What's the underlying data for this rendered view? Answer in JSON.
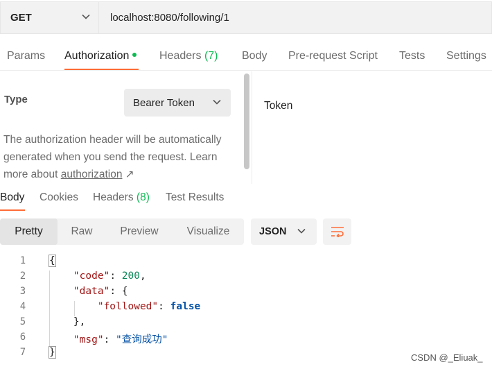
{
  "request": {
    "method": "GET",
    "url": "localhost:8080/following/1"
  },
  "request_tabs": {
    "params": "Params",
    "authorization": "Authorization",
    "headers_label": "Headers",
    "headers_count": "(7)",
    "body": "Body",
    "prerequest": "Pre-request Script",
    "tests": "Tests",
    "settings": "Settings"
  },
  "auth": {
    "type_label": "Type",
    "type_value": "Bearer Token",
    "description": "The authorization header will be automatically generated when you send the request. Learn more about ",
    "link_text": "authorization",
    "link_arrow": "↗",
    "token_label": "Token"
  },
  "response_tabs": {
    "body": "Body",
    "cookies": "Cookies",
    "headers_label": "Headers",
    "headers_count": "(8)",
    "test_results": "Test Results"
  },
  "format": {
    "modes": [
      "Pretty",
      "Raw",
      "Preview",
      "Visualize"
    ],
    "selected_mode": "Pretty",
    "language": "JSON"
  },
  "code": {
    "line_numbers": [
      "1",
      "2",
      "3",
      "4",
      "5",
      "6",
      "7"
    ],
    "open_brace": "{",
    "close_brace": "}",
    "code_key": "\"code\"",
    "code_value": "200",
    "data_key": "\"data\"",
    "followed_key": "\"followed\"",
    "followed_value": "false",
    "msg_key": "\"msg\"",
    "msg_value": "\"查询成功\""
  },
  "watermark": "CSDN @_Eliuak_",
  "icons": {
    "chevron": "chevron-down-icon",
    "wrap": "wrap-lines-icon",
    "external": "external-link-icon"
  },
  "colors": {
    "accent": "#ff6c37",
    "success": "#0cbb52"
  }
}
